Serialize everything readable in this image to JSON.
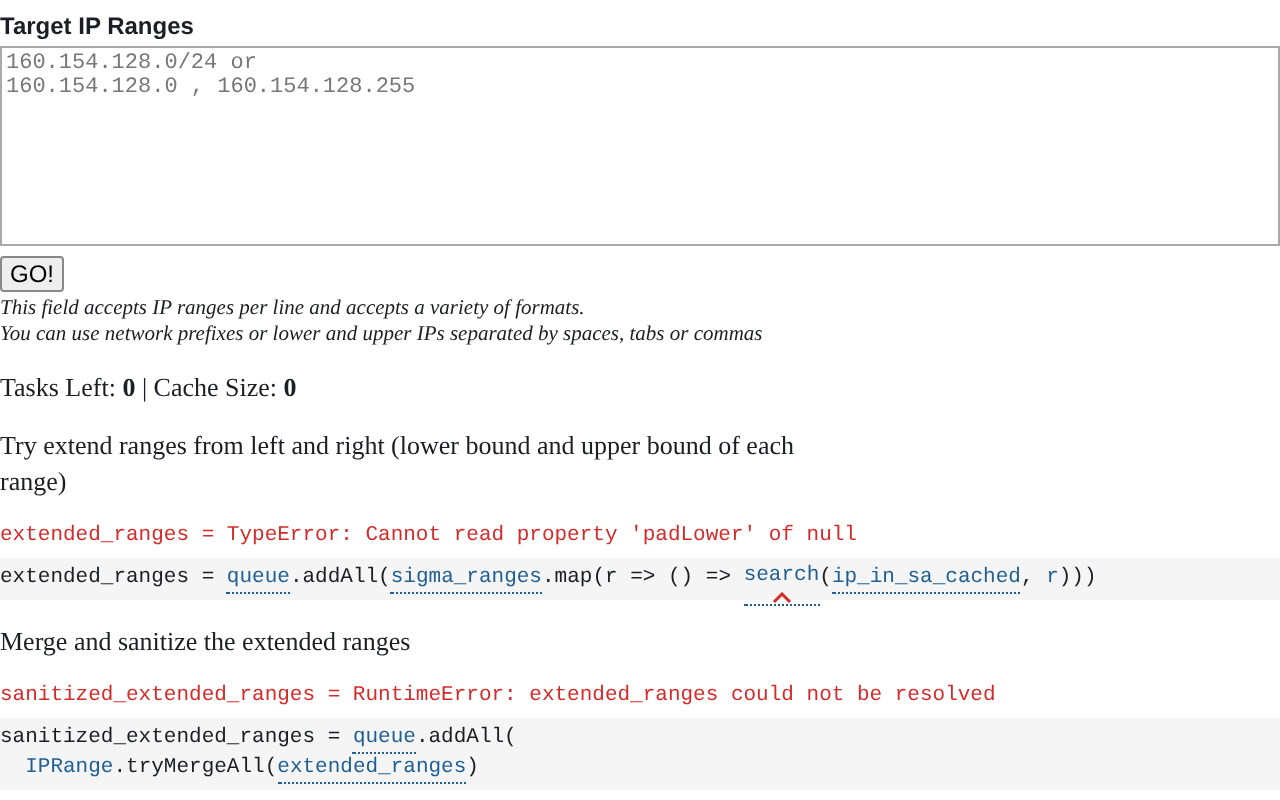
{
  "form": {
    "label": "Target IP Ranges",
    "placeholder": "160.154.128.0/24 or\n160.154.128.0 , 160.154.128.255",
    "button": "GO!",
    "help": [
      "This field accepts IP ranges per line and accepts a variety of formats.",
      "You can use network prefixes or lower and upper IPs separated by spaces, tabs or commas"
    ]
  },
  "status": "Tasks Left: **0** | Cache Size: **0**",
  "cells": [
    {
      "kind": "text",
      "text": "Try extend ranges from left and right (lower bound and upper bound of each range)"
    },
    {
      "kind": "error",
      "text": "extended_ranges = TypeError: Cannot read property 'padLower' of null"
    },
    {
      "kind": "code",
      "lines": [
        [
          {
            "kind": "plain",
            "text": "extended_ranges = "
          },
          {
            "kind": "ref",
            "text": "queue"
          },
          {
            "kind": "plain",
            "text": ".addAll("
          },
          {
            "kind": "ref",
            "text": "sigma_ranges"
          },
          {
            "kind": "plain",
            "text": ".map(r => () => "
          },
          {
            "kind": "ref",
            "text": "search",
            "flagged": true
          },
          {
            "kind": "plain",
            "text": "("
          },
          {
            "kind": "ref",
            "text": "ip_in_sa_cached"
          },
          {
            "kind": "plain",
            "text": ", "
          },
          {
            "kind": "var",
            "text": "r"
          },
          {
            "kind": "plain",
            "text": ")))"
          }
        ]
      ]
    },
    {
      "kind": "text",
      "text": "Merge and sanitize the extended ranges"
    },
    {
      "kind": "error",
      "text": "sanitized_extended_ranges = RuntimeError: extended_ranges could not be resolved"
    },
    {
      "kind": "code",
      "lines": [
        [
          {
            "kind": "plain",
            "text": "sanitized_extended_ranges = "
          },
          {
            "kind": "ref",
            "text": "queue"
          },
          {
            "kind": "plain",
            "text": ".addAll("
          }
        ],
        [
          {
            "kind": "var",
            "text": "  IPRange"
          },
          {
            "kind": "plain",
            "text": ".tryMergeAll("
          },
          {
            "kind": "ref",
            "text": "extended_ranges"
          },
          {
            "kind": "plain",
            "text": ")"
          }
        ]
      ]
    }
  ]
}
